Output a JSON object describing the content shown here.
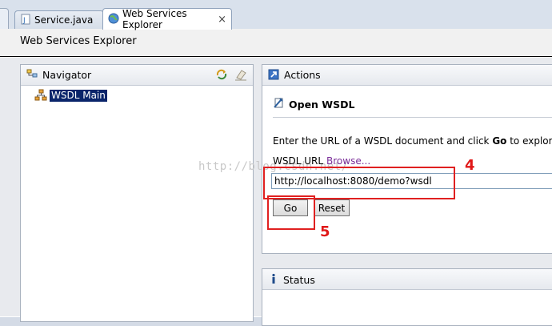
{
  "tabs": [
    {
      "label": "Service.java",
      "icon": "java-file-icon"
    },
    {
      "label": "Web Services Explorer",
      "icon": "globe-icon",
      "close": "×"
    }
  ],
  "header": {
    "title": "Web Services Explorer"
  },
  "navigator": {
    "title": "Navigator",
    "tree": [
      {
        "label": "WSDL Main"
      }
    ]
  },
  "watermark": "http://blog.csdn.net/",
  "actions": {
    "title": "Actions",
    "section_title": "Open WSDL",
    "instruction_pre": "Enter the URL of a WSDL document and click ",
    "instruction_bold": "Go",
    "instruction_post": " to explore.",
    "url_label": "WSDL URL",
    "browse_link": "Browse...",
    "url_value": "http://localhost:8080/demo?wsdl",
    "go_button": "Go",
    "reset_button": "Reset"
  },
  "status": {
    "title": "Status"
  },
  "annotations": {
    "step4": "4",
    "step5": "5",
    "color": "#e02020"
  }
}
